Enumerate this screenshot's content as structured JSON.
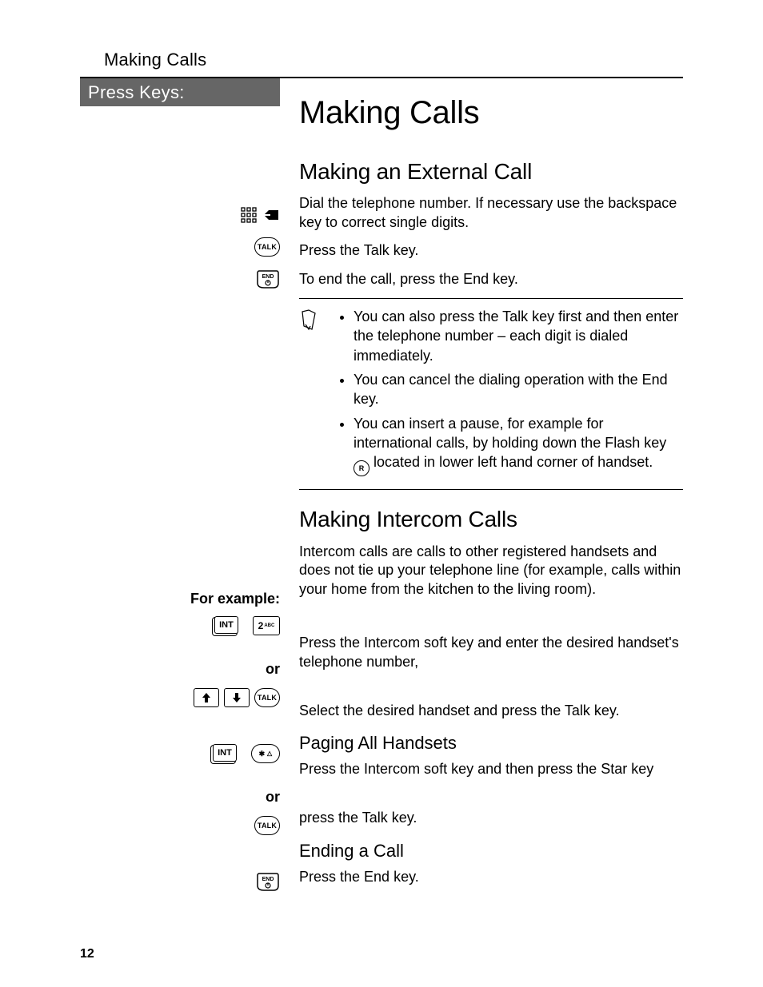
{
  "running_head": "Making Calls",
  "sidebar_title": "Press Keys:",
  "title": "Making Calls",
  "sections": {
    "external": {
      "heading": "Making an External Call",
      "dial": "Dial the telephone number. If necessary use the backspace key to correct single digits.",
      "press_talk": "Press the Talk key.",
      "end_call": "To end the call, press the End key.",
      "note1": "You can also press the Talk key first and then enter the telephone number  – each digit is dialed immediately.",
      "note2": "You can cancel the dialing operation with the End key.",
      "note3a": "You can insert a pause, for example for international calls, by holding down the Flash key ",
      "note3b": " located in lower left hand corner of handset."
    },
    "intercom": {
      "heading": "Making Intercom Calls",
      "intro": "Intercom calls are calls to other registered handsets and does not tie up your telephone line (for example, calls within your home from the kitchen to the living room).",
      "for_example": "For example:",
      "press_int": "Press the Intercom soft key and enter the desired handset's telephone number,",
      "or": "or",
      "select_handset": "Select the desired handset and press the Talk key."
    },
    "paging": {
      "heading": "Paging All Handsets",
      "press_int_star": "Press the Intercom soft key and then press the Star key",
      "press_talk": "press the Talk key."
    },
    "ending": {
      "heading": "Ending a Call",
      "press_end": "Press the End key."
    }
  },
  "keys": {
    "talk": "TALK",
    "end": "END",
    "int": "INT",
    "two": "2",
    "abc": "ABC",
    "star": "✱",
    "bell": "△",
    "flash": "R"
  },
  "page_number": "12"
}
